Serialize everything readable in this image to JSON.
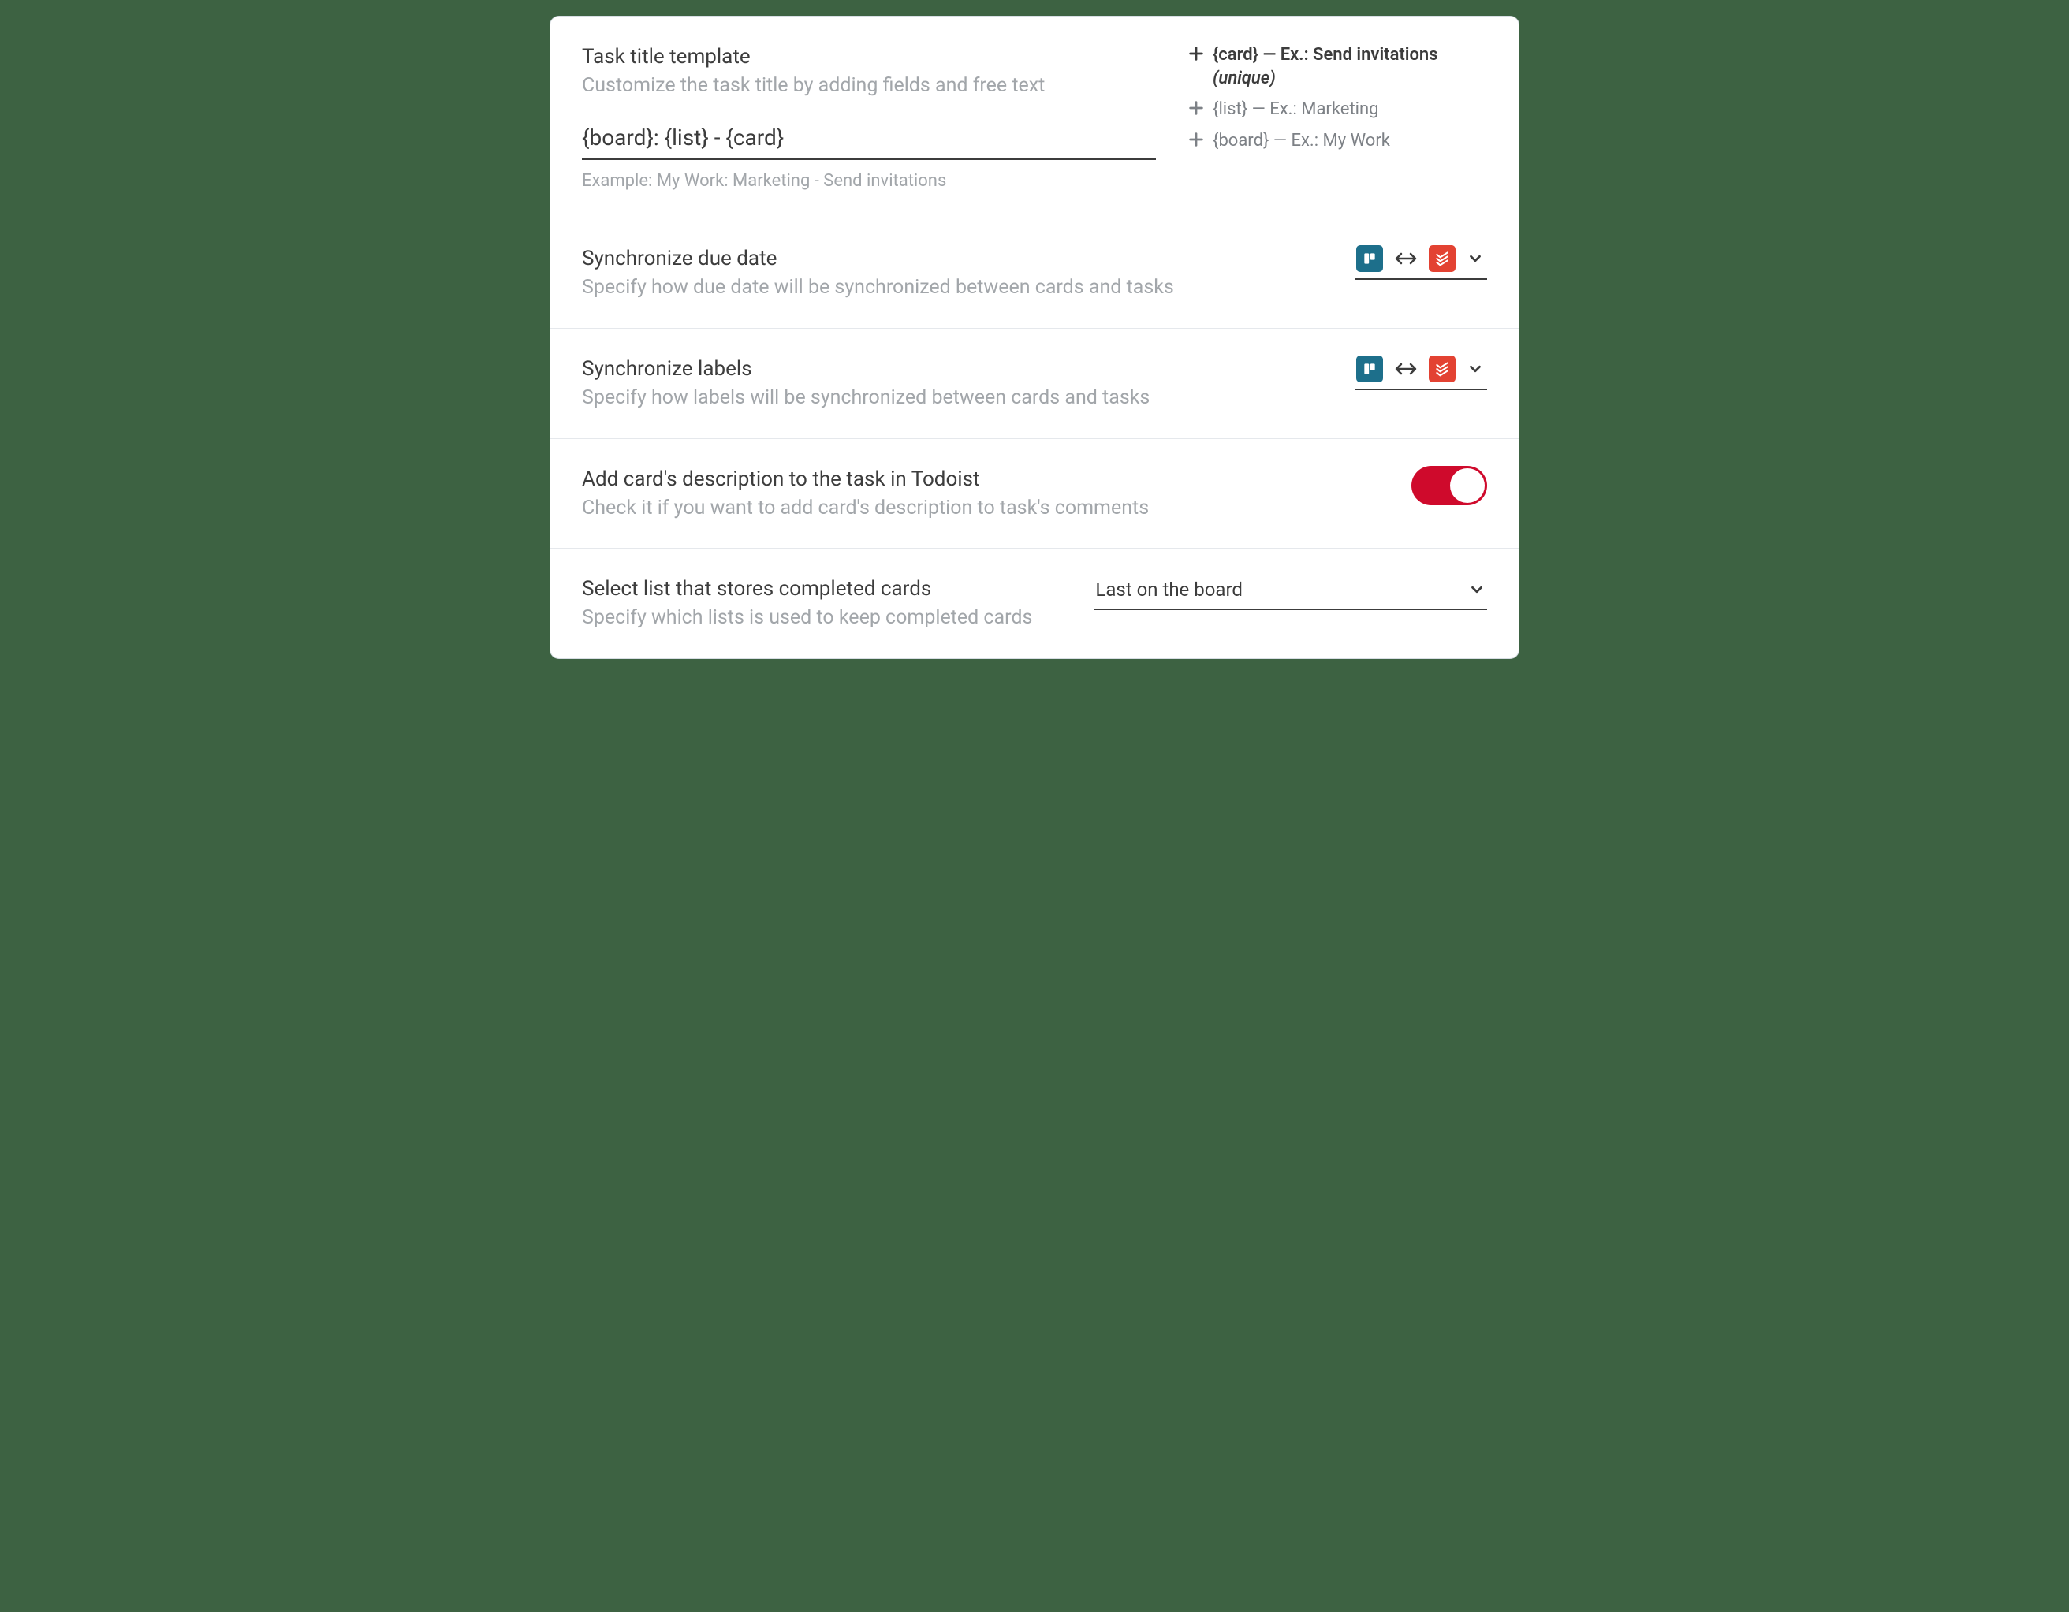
{
  "templateSection": {
    "title": "Task title template",
    "desc": "Customize the task title by adding fields and free text",
    "value": "{board}: {list} - {card}",
    "exampleLabel": "Example: My Work: Marketing - Send invitations",
    "tokens": [
      {
        "name": "{card}",
        "example": " — Ex.: Send invitations ",
        "suffix": "(unique)",
        "active": true
      },
      {
        "name": "{list}",
        "example": " — Ex.: Marketing",
        "suffix": "",
        "active": false
      },
      {
        "name": "{board}",
        "example": " — Ex.: My Work",
        "suffix": "",
        "active": false
      }
    ]
  },
  "syncDueDate": {
    "title": "Synchronize due date",
    "desc": "Specify how due date will be synchronized between cards and tasks"
  },
  "syncLabels": {
    "title": "Synchronize labels",
    "desc": "Specify how labels will be synchronized between cards and tasks"
  },
  "addDescription": {
    "title": "Add card's description to the task in Todoist",
    "desc": "Check it if you want to add card's description to task's comments",
    "enabled": true
  },
  "completedList": {
    "title": "Select list that stores completed cards",
    "desc": "Specify which lists is used to keep completed cards",
    "value": "Last on the board"
  }
}
